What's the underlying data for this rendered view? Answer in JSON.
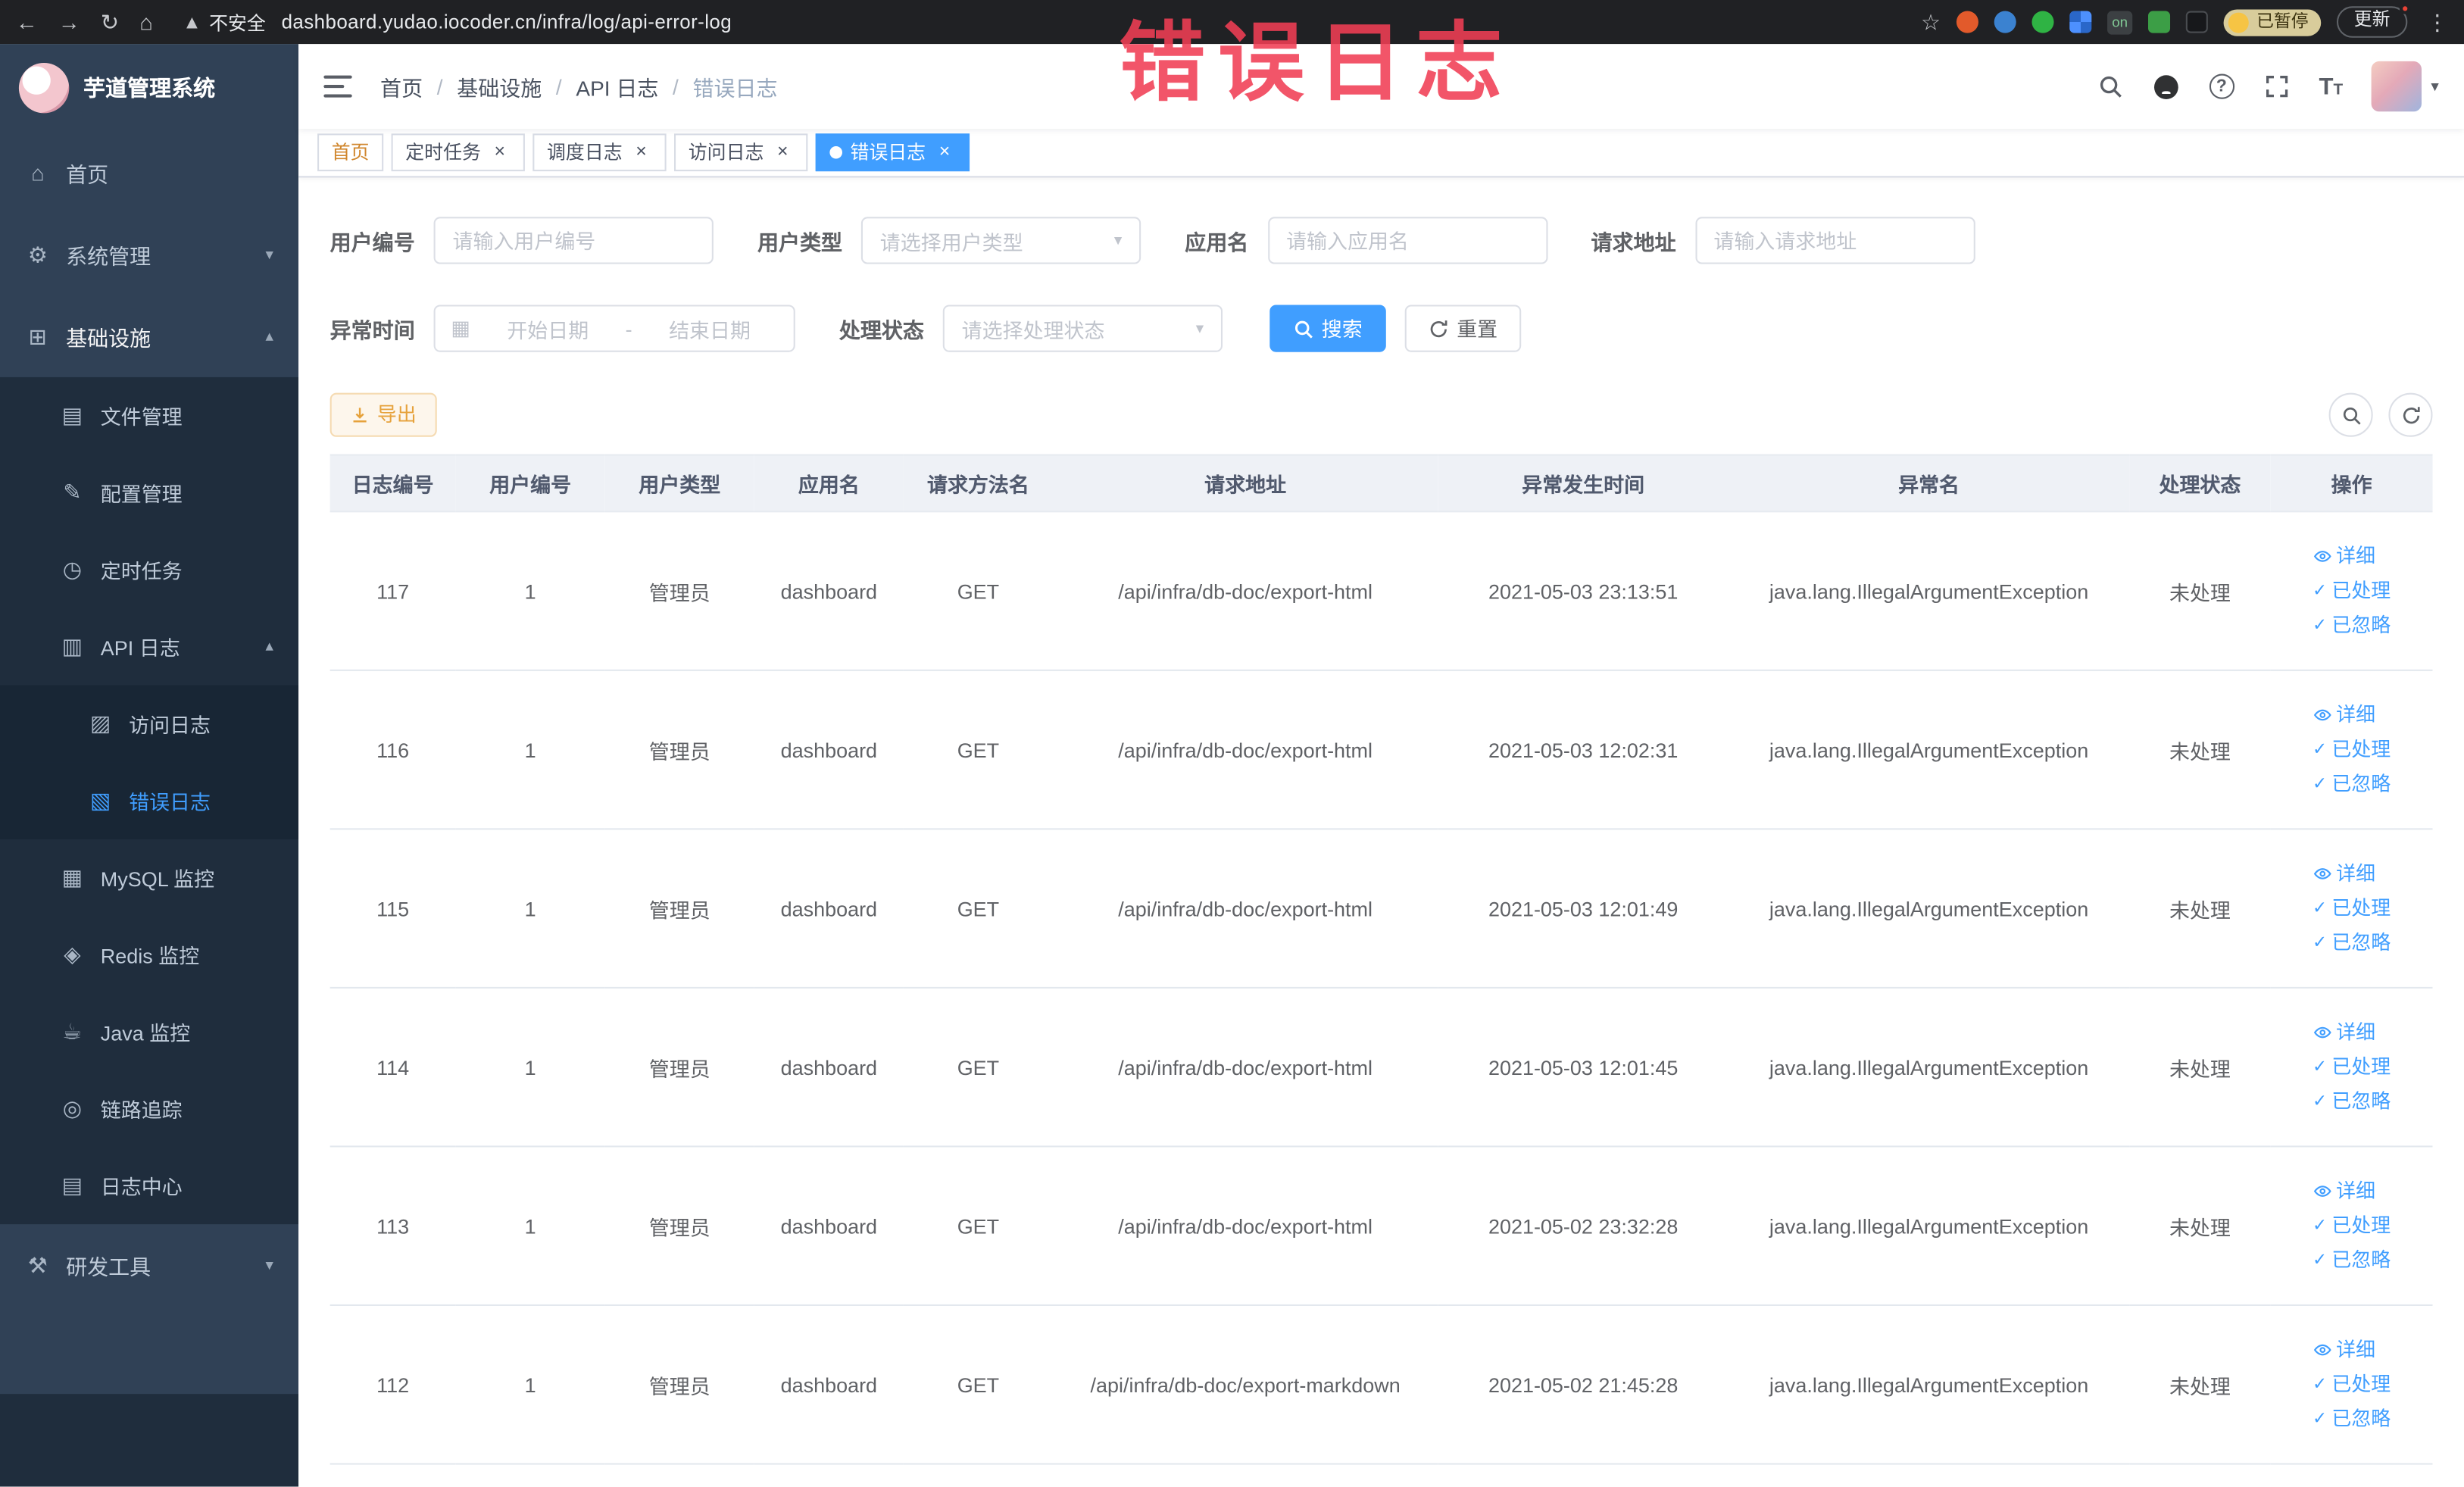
{
  "browser": {
    "security_label": "不安全",
    "url": "dashboard.yudao.iocoder.cn/infra/log/api-error-log",
    "extension_on_badge": "on",
    "paused_badge": "已暂停",
    "update_label": "更新"
  },
  "watermark": "错误日志",
  "sidebar": {
    "app_title": "芋道管理系统",
    "items": {
      "home": "首页",
      "system": "系统管理",
      "infra": "基础设施",
      "file": "文件管理",
      "config": "配置管理",
      "job": "定时任务",
      "api_log": "API 日志",
      "access_log": "访问日志",
      "error_log": "错误日志",
      "mysql": "MySQL 监控",
      "redis": "Redis 监控",
      "java": "Java 监控",
      "trace": "链路追踪",
      "log_center": "日志中心",
      "dev_tools": "研发工具"
    }
  },
  "header": {
    "breadcrumb": [
      "首页",
      "基础设施",
      "API 日志",
      "错误日志"
    ],
    "breadcrumb_separator": "/"
  },
  "tabs": [
    {
      "label": "首页"
    },
    {
      "label": "定时任务"
    },
    {
      "label": "调度日志"
    },
    {
      "label": "访问日志"
    },
    {
      "label": "错误日志"
    }
  ],
  "filters": {
    "user_id_label": "用户编号",
    "user_id_placeholder": "请输入用户编号",
    "user_type_label": "用户类型",
    "user_type_placeholder": "请选择用户类型",
    "app_name_label": "应用名",
    "app_name_placeholder": "请输入应用名",
    "request_url_label": "请求地址",
    "request_url_placeholder": "请输入请求地址",
    "time_label": "异常时间",
    "time_start_placeholder": "开始日期",
    "time_separator": "-",
    "time_end_placeholder": "结束日期",
    "status_label": "处理状态",
    "status_placeholder": "请选择处理状态",
    "search_label": "搜索",
    "reset_label": "重置"
  },
  "toolbar": {
    "export_label": "导出"
  },
  "table": {
    "columns": [
      "日志编号",
      "用户编号",
      "用户类型",
      "应用名",
      "请求方法名",
      "请求地址",
      "异常发生时间",
      "异常名",
      "处理状态",
      "操作"
    ],
    "actions": {
      "detail": "详细",
      "processed": "已处理",
      "ignored": "已忽略"
    },
    "rows": [
      {
        "id": "117",
        "user_id": "1",
        "user_type": "管理员",
        "app": "dashboard",
        "method": "GET",
        "url": "/api/infra/db-doc/export-html",
        "time": "2021-05-03 23:13:51",
        "exception": "java.lang.IllegalArgumentException",
        "status": "未处理"
      },
      {
        "id": "116",
        "user_id": "1",
        "user_type": "管理员",
        "app": "dashboard",
        "method": "GET",
        "url": "/api/infra/db-doc/export-html",
        "time": "2021-05-03 12:02:31",
        "exception": "java.lang.IllegalArgumentException",
        "status": "未处理"
      },
      {
        "id": "115",
        "user_id": "1",
        "user_type": "管理员",
        "app": "dashboard",
        "method": "GET",
        "url": "/api/infra/db-doc/export-html",
        "time": "2021-05-03 12:01:49",
        "exception": "java.lang.IllegalArgumentException",
        "status": "未处理"
      },
      {
        "id": "114",
        "user_id": "1",
        "user_type": "管理员",
        "app": "dashboard",
        "method": "GET",
        "url": "/api/infra/db-doc/export-html",
        "time": "2021-05-03 12:01:45",
        "exception": "java.lang.IllegalArgumentException",
        "status": "未处理"
      },
      {
        "id": "113",
        "user_id": "1",
        "user_type": "管理员",
        "app": "dashboard",
        "method": "GET",
        "url": "/api/infra/db-doc/export-html",
        "time": "2021-05-02 23:32:28",
        "exception": "java.lang.IllegalArgumentException",
        "status": "未处理"
      },
      {
        "id": "112",
        "user_id": "1",
        "user_type": "管理员",
        "app": "dashboard",
        "method": "GET",
        "url": "/api/infra/db-doc/export-markdown",
        "time": "2021-05-02 21:45:28",
        "exception": "java.lang.IllegalArgumentException",
        "status": "未处理"
      }
    ]
  }
}
